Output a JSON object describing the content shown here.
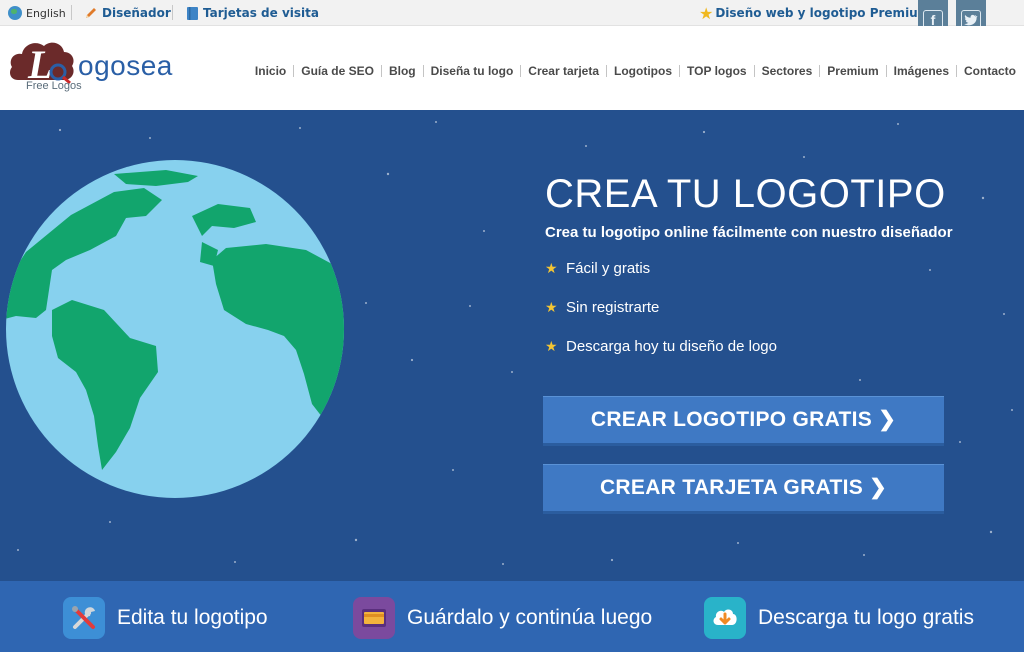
{
  "topbar": {
    "language": "English",
    "designer": "Diseñador",
    "cards": "Tarjetas de visita",
    "premium": "Diseño web y logotipo Premium",
    "facebook_glyph": "f",
    "twitter_glyph": "t"
  },
  "logo": {
    "letter": "L",
    "word": "ogosea",
    "tagline": "Free Logos"
  },
  "nav": {
    "items": [
      "Inicio",
      "Guía de SEO",
      "Blog",
      "Diseña tu logo",
      "Crear tarjeta",
      "Logotipos",
      "TOP logos",
      "Sectores",
      "Premium",
      "Imágenes",
      "Contacto"
    ]
  },
  "hero": {
    "title": "CREA TU LOGOTIPO",
    "subtitle": "Crea tu logotipo online fácilmente con nuestro diseñador",
    "bullets": [
      "Fácil y gratis",
      "Sin registrarte",
      "Descarga hoy tu diseño de logo"
    ],
    "cta_logo": "CREAR LOGOTIPO GRATIS ❯",
    "cta_card": "CREAR TARJETA GRATIS ❯"
  },
  "features": [
    {
      "label": "Edita tu logotipo",
      "icon": "tools-icon"
    },
    {
      "label": "Guárdalo y continúa luego",
      "icon": "save-card-icon"
    },
    {
      "label": "Descarga tu logo gratis",
      "icon": "cloud-download-icon"
    }
  ],
  "colors": {
    "hero_bg": "#24508e",
    "button": "#3f79c4",
    "strip": "#2f66b2",
    "ocean": "#87d1ee",
    "land": "#12a56d",
    "star": "#f3c534",
    "logo_brand": "#2a5fa6",
    "logo_cloud": "#6b2a2a"
  }
}
